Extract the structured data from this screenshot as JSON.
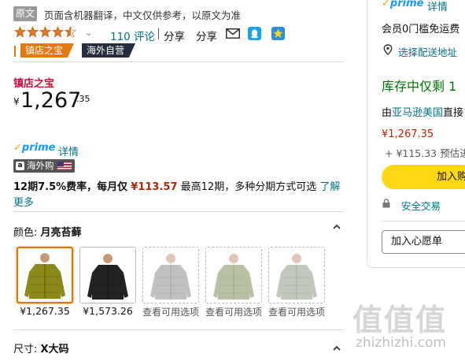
{
  "translation": {
    "badge": "原文",
    "note": "页面含机器翻译，中文仅供参考，以原文为准"
  },
  "rating": {
    "stars": 4.5,
    "reviews": "110 评论",
    "share_sep": "|",
    "share1": "分享",
    "share2": "分享"
  },
  "badges": {
    "store_treasure": "镇店之宝",
    "overseas": "海外自营"
  },
  "price": {
    "label": "镇店之宝",
    "currency": "¥",
    "whole": "1,267",
    "fraction": ".35"
  },
  "prime": {
    "logo": "prime",
    "detail": "详情"
  },
  "global": {
    "a": "a",
    "text": "海外购"
  },
  "installment": {
    "period": "12期7.5%费率，每月仅",
    "amount": "¥113.57",
    "rest": "最高12期，多种分期方式可选",
    "link": "了解更多"
  },
  "color": {
    "label": "颜色:",
    "value": "月亮苔藓"
  },
  "swatches": [
    {
      "label": "¥1,267.35",
      "jacket": "#8a8a1a"
    },
    {
      "label": "¥1,573.26",
      "jacket": "#222222"
    },
    {
      "label": "查看可用选项",
      "jacket": "#8e8e92"
    },
    {
      "label": "查看可用选项",
      "jacket": "#7f8f5a"
    },
    {
      "label": "查看可用选项",
      "jacket": "#8e9a86"
    }
  ],
  "size": {
    "label": "尺寸:",
    "value": "X大码"
  },
  "buybox": {
    "prime": "prime",
    "detail": "详情",
    "free_ship": "会员0门槛免运费",
    "address": "选择配送地址",
    "stock": "库存中仅剩 1",
    "ship_prefix": "由",
    "ship_link": "亚马逊美国",
    "ship_suffix": "直接",
    "price": "¥1,267.35",
    "fee": "+ ¥115.33 预估进",
    "add_cart": "加入购",
    "secure": "安全交易",
    "wishlist": "加入心愿单"
  },
  "watermark": {
    "text": "值值值",
    "url": "zhizhizhi.com"
  },
  "colors": {
    "link": "#007185",
    "price_red": "#b12704",
    "orange": "#e47911",
    "cart_yellow": "#ffd814",
    "stock_green": "#007600"
  }
}
